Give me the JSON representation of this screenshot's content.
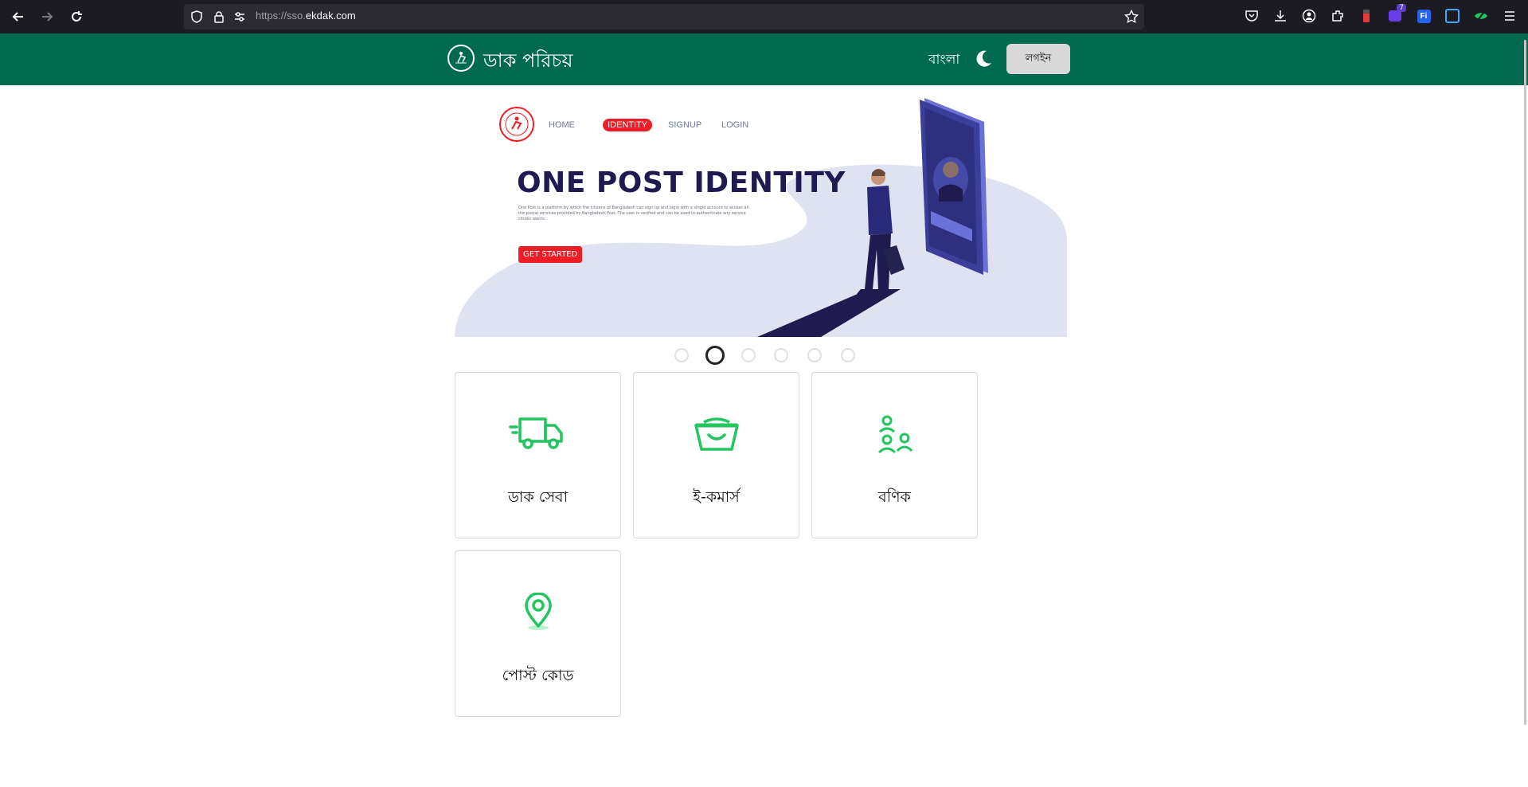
{
  "browser": {
    "url_prefix": "https://sso.",
    "url_domain": "ekdak.com",
    "ext_badge": "7"
  },
  "header": {
    "brand": "ডাক পরিচয়",
    "language": "বাংলা",
    "login_label": "লগইন"
  },
  "hero": {
    "nav": [
      "HOME",
      "IDENTITY",
      "SIGNUP",
      "LOGIN"
    ],
    "title": "ONE POST IDENTITY",
    "description": "One Post is a platform by which the citizens of Bangladesh can sign up and login with a single account to access all the postal services provided by Bangladesh Post. The user is verified and can be used to authenticate any service citizen wants.",
    "cta": "GET STARTED"
  },
  "carousel": {
    "count": 6,
    "active_index": 1
  },
  "services": [
    {
      "label": "ডাক সেবা",
      "icon": "truck-icon"
    },
    {
      "label": "ই-কমার্স",
      "icon": "basket-icon"
    },
    {
      "label": "বণিক",
      "icon": "people-icon"
    },
    {
      "label": "পোস্ট কোড",
      "icon": "location-pin-icon"
    }
  ],
  "colors": {
    "header": "#006a4e",
    "accent": "#ee1c25",
    "icon": "#22c55e",
    "hero_title": "#1f1a4f"
  }
}
